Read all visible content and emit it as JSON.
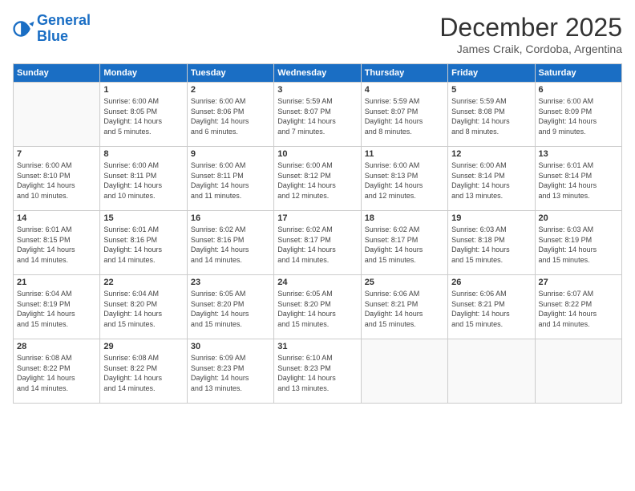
{
  "logo": {
    "line1": "General",
    "line2": "Blue"
  },
  "title": "December 2025",
  "subtitle": "James Craik, Cordoba, Argentina",
  "headers": [
    "Sunday",
    "Monday",
    "Tuesday",
    "Wednesday",
    "Thursday",
    "Friday",
    "Saturday"
  ],
  "weeks": [
    [
      {
        "day": "",
        "info": ""
      },
      {
        "day": "1",
        "info": "Sunrise: 6:00 AM\nSunset: 8:05 PM\nDaylight: 14 hours\nand 5 minutes."
      },
      {
        "day": "2",
        "info": "Sunrise: 6:00 AM\nSunset: 8:06 PM\nDaylight: 14 hours\nand 6 minutes."
      },
      {
        "day": "3",
        "info": "Sunrise: 5:59 AM\nSunset: 8:07 PM\nDaylight: 14 hours\nand 7 minutes."
      },
      {
        "day": "4",
        "info": "Sunrise: 5:59 AM\nSunset: 8:07 PM\nDaylight: 14 hours\nand 8 minutes."
      },
      {
        "day": "5",
        "info": "Sunrise: 5:59 AM\nSunset: 8:08 PM\nDaylight: 14 hours\nand 8 minutes."
      },
      {
        "day": "6",
        "info": "Sunrise: 6:00 AM\nSunset: 8:09 PM\nDaylight: 14 hours\nand 9 minutes."
      }
    ],
    [
      {
        "day": "7",
        "info": "Sunrise: 6:00 AM\nSunset: 8:10 PM\nDaylight: 14 hours\nand 10 minutes."
      },
      {
        "day": "8",
        "info": "Sunrise: 6:00 AM\nSunset: 8:11 PM\nDaylight: 14 hours\nand 10 minutes."
      },
      {
        "day": "9",
        "info": "Sunrise: 6:00 AM\nSunset: 8:11 PM\nDaylight: 14 hours\nand 11 minutes."
      },
      {
        "day": "10",
        "info": "Sunrise: 6:00 AM\nSunset: 8:12 PM\nDaylight: 14 hours\nand 12 minutes."
      },
      {
        "day": "11",
        "info": "Sunrise: 6:00 AM\nSunset: 8:13 PM\nDaylight: 14 hours\nand 12 minutes."
      },
      {
        "day": "12",
        "info": "Sunrise: 6:00 AM\nSunset: 8:14 PM\nDaylight: 14 hours\nand 13 minutes."
      },
      {
        "day": "13",
        "info": "Sunrise: 6:01 AM\nSunset: 8:14 PM\nDaylight: 14 hours\nand 13 minutes."
      }
    ],
    [
      {
        "day": "14",
        "info": "Sunrise: 6:01 AM\nSunset: 8:15 PM\nDaylight: 14 hours\nand 14 minutes."
      },
      {
        "day": "15",
        "info": "Sunrise: 6:01 AM\nSunset: 8:16 PM\nDaylight: 14 hours\nand 14 minutes."
      },
      {
        "day": "16",
        "info": "Sunrise: 6:02 AM\nSunset: 8:16 PM\nDaylight: 14 hours\nand 14 minutes."
      },
      {
        "day": "17",
        "info": "Sunrise: 6:02 AM\nSunset: 8:17 PM\nDaylight: 14 hours\nand 14 minutes."
      },
      {
        "day": "18",
        "info": "Sunrise: 6:02 AM\nSunset: 8:17 PM\nDaylight: 14 hours\nand 15 minutes."
      },
      {
        "day": "19",
        "info": "Sunrise: 6:03 AM\nSunset: 8:18 PM\nDaylight: 14 hours\nand 15 minutes."
      },
      {
        "day": "20",
        "info": "Sunrise: 6:03 AM\nSunset: 8:19 PM\nDaylight: 14 hours\nand 15 minutes."
      }
    ],
    [
      {
        "day": "21",
        "info": "Sunrise: 6:04 AM\nSunset: 8:19 PM\nDaylight: 14 hours\nand 15 minutes."
      },
      {
        "day": "22",
        "info": "Sunrise: 6:04 AM\nSunset: 8:20 PM\nDaylight: 14 hours\nand 15 minutes."
      },
      {
        "day": "23",
        "info": "Sunrise: 6:05 AM\nSunset: 8:20 PM\nDaylight: 14 hours\nand 15 minutes."
      },
      {
        "day": "24",
        "info": "Sunrise: 6:05 AM\nSunset: 8:20 PM\nDaylight: 14 hours\nand 15 minutes."
      },
      {
        "day": "25",
        "info": "Sunrise: 6:06 AM\nSunset: 8:21 PM\nDaylight: 14 hours\nand 15 minutes."
      },
      {
        "day": "26",
        "info": "Sunrise: 6:06 AM\nSunset: 8:21 PM\nDaylight: 14 hours\nand 15 minutes."
      },
      {
        "day": "27",
        "info": "Sunrise: 6:07 AM\nSunset: 8:22 PM\nDaylight: 14 hours\nand 14 minutes."
      }
    ],
    [
      {
        "day": "28",
        "info": "Sunrise: 6:08 AM\nSunset: 8:22 PM\nDaylight: 14 hours\nand 14 minutes."
      },
      {
        "day": "29",
        "info": "Sunrise: 6:08 AM\nSunset: 8:22 PM\nDaylight: 14 hours\nand 14 minutes."
      },
      {
        "day": "30",
        "info": "Sunrise: 6:09 AM\nSunset: 8:23 PM\nDaylight: 14 hours\nand 13 minutes."
      },
      {
        "day": "31",
        "info": "Sunrise: 6:10 AM\nSunset: 8:23 PM\nDaylight: 14 hours\nand 13 minutes."
      },
      {
        "day": "",
        "info": ""
      },
      {
        "day": "",
        "info": ""
      },
      {
        "day": "",
        "info": ""
      }
    ]
  ]
}
